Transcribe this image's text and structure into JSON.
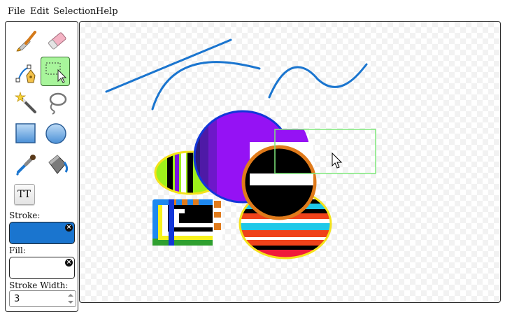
{
  "menu": {
    "file": "File",
    "edit": "Edit",
    "selection": "Selection",
    "help": "Help"
  },
  "tools": [
    {
      "name": "brush-tool",
      "icon": "paintbrush-icon"
    },
    {
      "name": "eraser-tool",
      "icon": "eraser-icon"
    },
    {
      "name": "pen-tool",
      "icon": "pen-nib-icon"
    },
    {
      "name": "select-tool",
      "icon": "selection-cursor-icon",
      "active": true
    },
    {
      "name": "magic-wand-tool",
      "icon": "magic-wand-icon"
    },
    {
      "name": "lasso-tool",
      "icon": "lasso-icon"
    },
    {
      "name": "rectangle-tool",
      "icon": "rectangle-icon"
    },
    {
      "name": "ellipse-tool",
      "icon": "ellipse-icon"
    },
    {
      "name": "eyedropper-tool",
      "icon": "eyedropper-icon"
    },
    {
      "name": "fill-bucket-tool",
      "icon": "paint-bucket-icon"
    }
  ],
  "text_tool": {
    "glyph": "TT"
  },
  "properties": {
    "stroke_label": "Stroke:",
    "stroke_color": "#1a75cf",
    "fill_label": "Fill:",
    "fill_color": "transparent",
    "stroke_width_label": "Stroke Width:",
    "stroke_width_value": "3"
  },
  "colors": {
    "active_tool_bg": "#a8f59b",
    "selection_outline": "#7ee87a",
    "stroke_blue": "#1a75cf"
  }
}
